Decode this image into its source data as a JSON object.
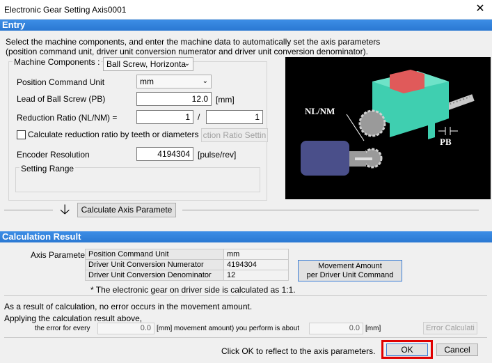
{
  "window": {
    "title": "Electronic Gear Setting Axis0001",
    "close_glyph": "✕"
  },
  "entry": {
    "header": "Entry",
    "intro_line1": "Select the machine components, and enter the machine data to automatically set the axis parameters",
    "intro_line2": "(position command unit, driver unit conversion numerator and driver unit conversion denominator).",
    "machine_components_label": "Machine Components :",
    "machine_components_value": "Ball Screw, Horizonta",
    "position_command_unit_label": "Position Command Unit",
    "position_command_unit_value": "mm",
    "lead_label": "Lead of Ball Screw (PB)",
    "lead_value": "12.0",
    "lead_unit": "[mm]",
    "reduction_label": "Reduction Ratio (NL/NM) =",
    "reduction_nl": "1",
    "reduction_sep": "/",
    "reduction_nm": "1",
    "calc_by_teeth_label": "Calculate reduction ratio by teeth or diameters",
    "calc_by_teeth_checked": false,
    "reduction_setting_button": "ction Ratio Settin",
    "encoder_label": "Encoder Resolution",
    "encoder_value": "4194304",
    "encoder_unit": "[pulse/rev]",
    "setting_range_label": "Setting Range",
    "diagram_label_nl_nm": "NL/NM",
    "diagram_label_pb": "PB",
    "calc_axis_button": "Calculate  Axis Paramete"
  },
  "result": {
    "header": "Calculation Result",
    "axis_parameters_label": "Axis Parameters",
    "rows": [
      {
        "name": "Position Command Unit",
        "value": "mm"
      },
      {
        "name": "Driver Unit Conversion Numerator",
        "value": "4194304"
      },
      {
        "name": "Driver Unit Conversion Denominator",
        "value": "12"
      }
    ],
    "movement_button_line1": "Movement  Amount",
    "movement_button_line2": "per Driver Unit Command",
    "note": "* The electronic gear on driver side is calculated as 1:1.",
    "no_error_text": "As a result of calculation, no error occurs in the movement amount.",
    "applying_text": "Applying the calculation result above,",
    "error_every_label": "the error for every",
    "error_every_value": "0.0",
    "error_mid_text": "[mm] movement amount) you perform is about",
    "error_about_value": "0.0",
    "error_unit": "[mm]",
    "error_calc_button": "Error Calculati"
  },
  "footer": {
    "hint": "Click OK to reflect to the axis parameters.",
    "ok_label": "OK",
    "cancel_label": "Cancel",
    "highlight_color": "#e00000"
  },
  "colors": {
    "section_blue": "#2a78d2",
    "block_teal": "#3fcfb0",
    "block_red": "#e05a5a"
  }
}
